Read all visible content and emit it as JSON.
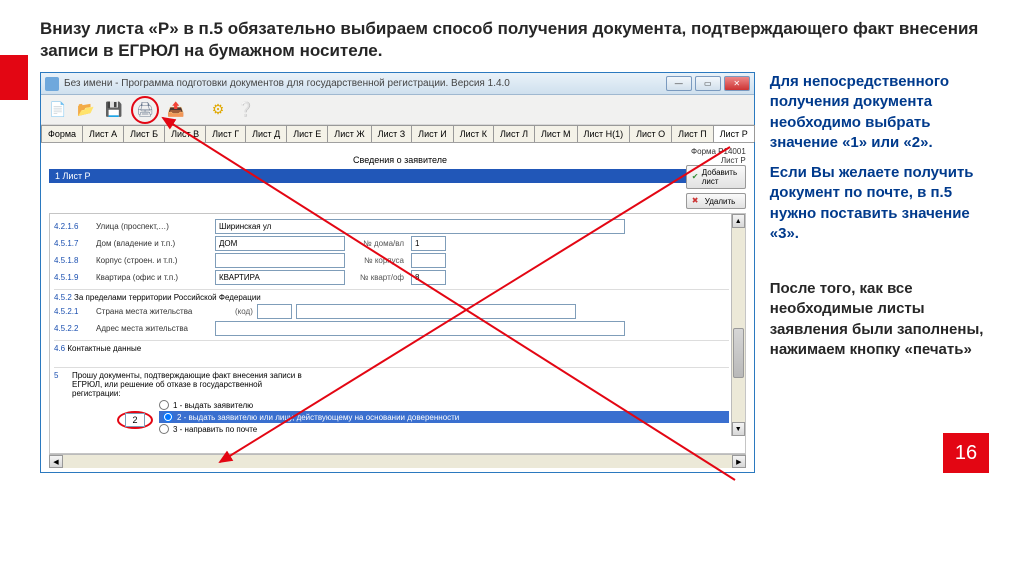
{
  "header": "Внизу листа «Р» в п.5 обязательно выбираем способ получения документа, подтверждающего факт внесения записи в ЕГРЮЛ на бумажном носителе.",
  "window": {
    "title": "Без имени - Программа подготовки документов для государственной регистрации. Версия 1.4.0"
  },
  "tabs": [
    "Форма",
    "Лист А",
    "Лист Б",
    "Лист В",
    "Лист Г",
    "Лист Д",
    "Лист Е",
    "Лист Ж",
    "Лист З",
    "Лист И",
    "Лист К",
    "Лист Л",
    "Лист М",
    "Лист Н(1)",
    "Лист О",
    "Лист П",
    "Лист Р"
  ],
  "form": {
    "code": "Форма Р14001",
    "sheet": "Лист Р",
    "title": "Сведения о заявителе",
    "band": "1 Лист Р",
    "btn_add": "Добавить лист",
    "btn_del": "Удалить"
  },
  "rows": {
    "r1": {
      "num": "4.2.1.6",
      "label": "Улица (проспект,…)",
      "val": "Ширинская ул"
    },
    "r2": {
      "num": "4.5.1.7",
      "label": "Дом (владение и т.п.)",
      "val": "ДОМ",
      "sub": "№ дома/вл",
      "subval": "1"
    },
    "r3": {
      "num": "4.5.1.8",
      "label": "Корпус (строен. и т.п.)",
      "val": "",
      "sub": "№ корпуса",
      "subval": ""
    },
    "r4": {
      "num": "4.5.1.9",
      "label": "Квартира (офис и т.п.)",
      "val": "КВАРТИРА",
      "sub": "№ кварт/оф",
      "subval": "8"
    },
    "s452": {
      "num": "4.5.2",
      "label": "За пределами территории Российской Федерации"
    },
    "r521": {
      "num": "4.5.2.1",
      "label": "Страна места жительства",
      "code_lbl": "(код)"
    },
    "r522": {
      "num": "4.5.2.2",
      "label": "Адрес места жительства"
    },
    "s46": {
      "num": "4.6",
      "label": "Контактные данные"
    },
    "section5": {
      "num": "5",
      "label": "Прошу документы, подтверждающие факт внесения записи в ЕГРЮЛ, или решение об отказе в государственной регистрации:"
    },
    "chosen": "2",
    "opt1": "1 - выдать заявителю",
    "opt2": "2 - выдать заявителю или лицу, действующему на основании доверенности",
    "opt3": "3 - направить по почте"
  },
  "side": {
    "p1": "Для непосредственного получения документа необходимо выбрать значение «1» или «2».",
    "p2": "Если Вы желаете получить документ по почте, в п.5 нужно поставить  значение «3».",
    "p3": "После того, как все необходимые листы заявления были заполнены, нажимаем кнопку «печать»"
  },
  "page": "16"
}
